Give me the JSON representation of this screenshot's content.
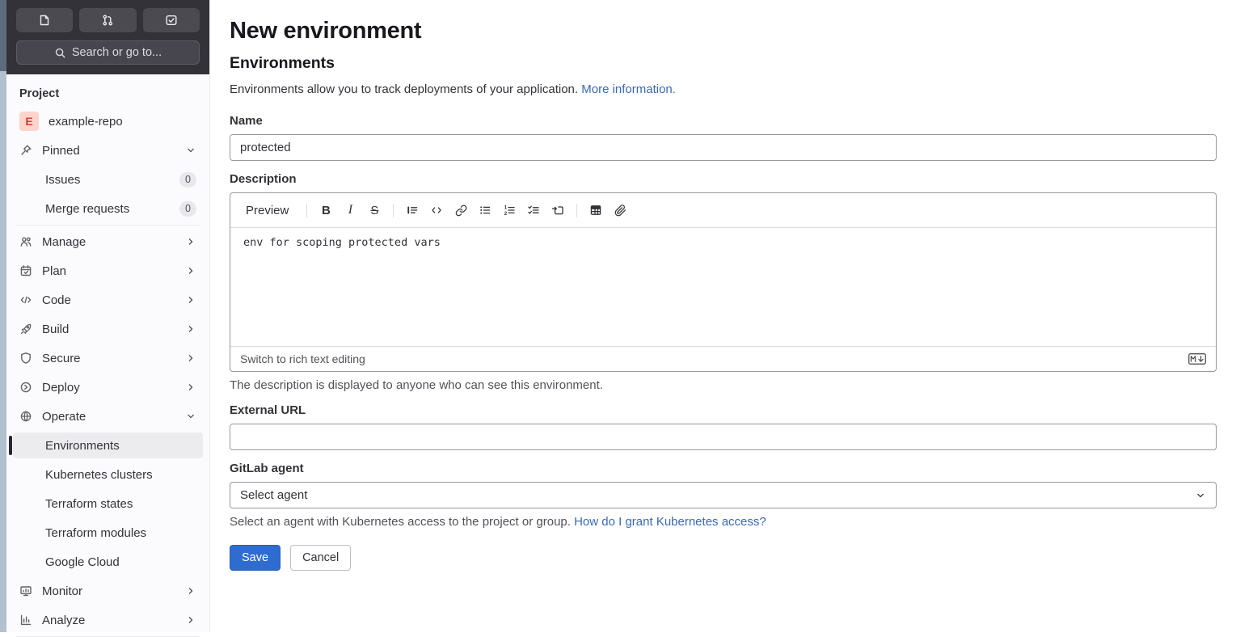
{
  "colors": {
    "sidebar_header_bg": "#333238",
    "sidebar_bg": "#fbfafd",
    "active_item_bg": "#ececef",
    "link_blue": "#3a68b8",
    "save_button_blue": "#2f6cd0",
    "avatar_bg": "#fdd4cc",
    "avatar_text": "#cf4030"
  },
  "sidebar": {
    "search_label": "Search or go to...",
    "section_label": "Project",
    "project": {
      "avatar_letter": "E",
      "name": "example-repo"
    },
    "pinned": {
      "label": "Pinned",
      "items": [
        {
          "label": "Issues",
          "count": "0"
        },
        {
          "label": "Merge requests",
          "count": "0"
        }
      ]
    },
    "nav": [
      {
        "label": "Manage"
      },
      {
        "label": "Plan"
      },
      {
        "label": "Code"
      },
      {
        "label": "Build"
      },
      {
        "label": "Secure"
      },
      {
        "label": "Deploy"
      },
      {
        "label": "Operate"
      }
    ],
    "operate_children": [
      {
        "label": "Environments"
      },
      {
        "label": "Kubernetes clusters"
      },
      {
        "label": "Terraform states"
      },
      {
        "label": "Terraform modules"
      },
      {
        "label": "Google Cloud"
      }
    ],
    "nav_bottom": [
      {
        "label": "Monitor"
      },
      {
        "label": "Analyze"
      }
    ]
  },
  "main": {
    "title": "New environment",
    "section_title": "Environments",
    "intro_text": "Environments allow you to track deployments of your application. ",
    "intro_link": "More information.",
    "name_field": {
      "label": "Name",
      "value": "protected"
    },
    "description_field": {
      "label": "Description",
      "toolbar": {
        "preview_label": "Preview",
        "bold_glyph": "B",
        "italic_glyph": "I",
        "strike_glyph": "S"
      },
      "value": "env for scoping protected vars",
      "footer_link": "Switch to rich text editing",
      "help_text": "The description is displayed to anyone who can see this environment."
    },
    "external_url_field": {
      "label": "External URL",
      "value": ""
    },
    "agent_field": {
      "label": "GitLab agent",
      "selected": "Select agent",
      "help_text": "Select an agent with Kubernetes access to the project or group. ",
      "help_link": "How do I grant Kubernetes access?"
    },
    "actions": {
      "save": "Save",
      "cancel": "Cancel"
    }
  }
}
